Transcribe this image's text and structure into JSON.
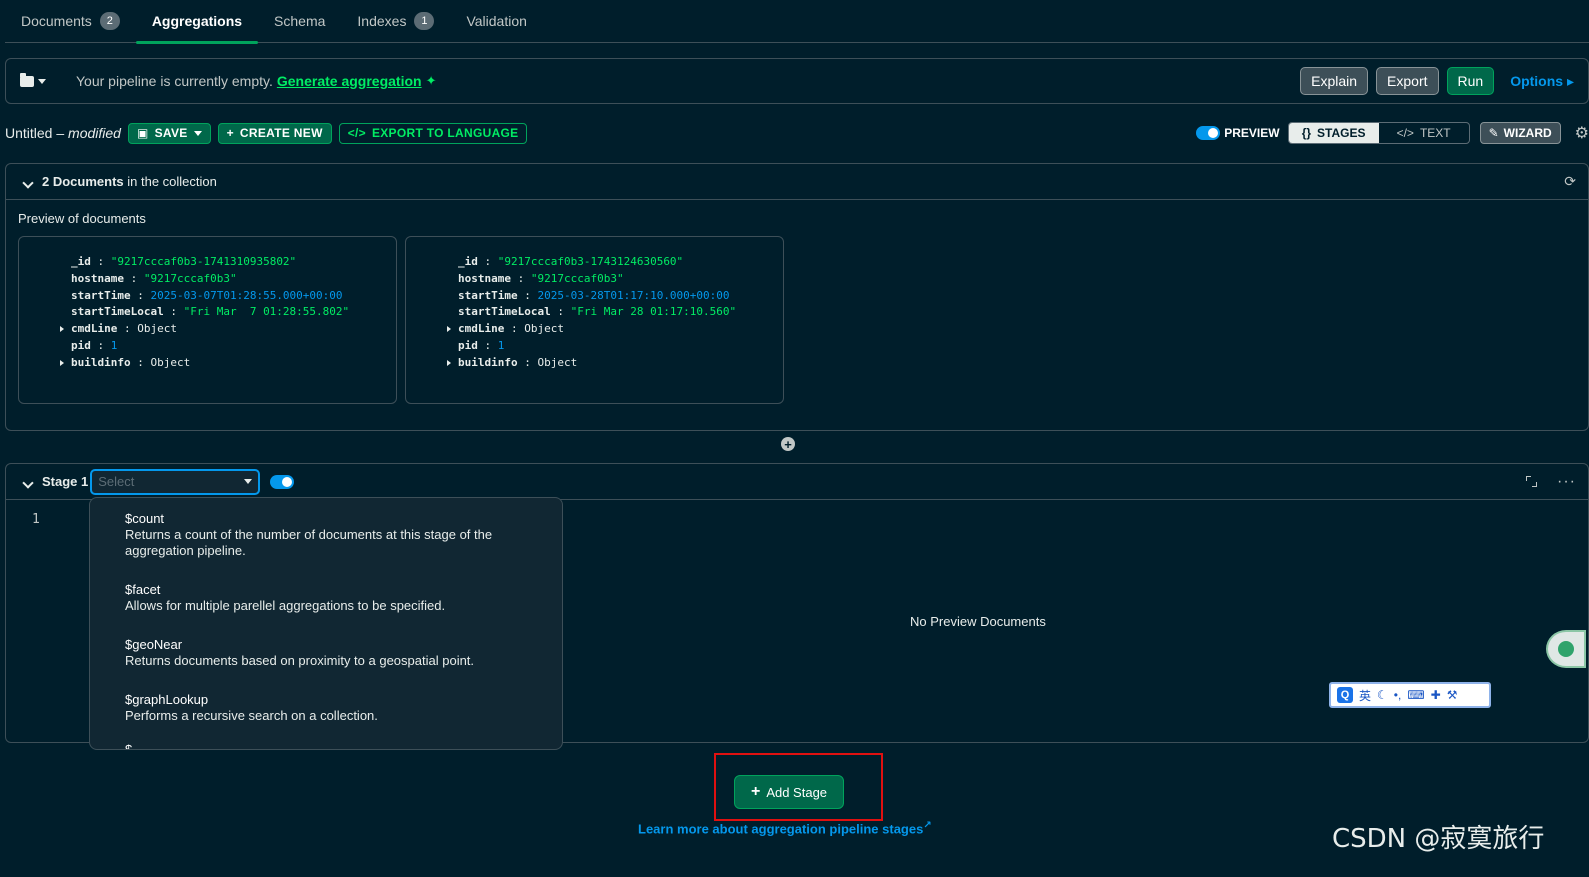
{
  "tabs": [
    {
      "label": "Documents",
      "badge": "2"
    },
    {
      "label": "Aggregations",
      "badge": null
    },
    {
      "label": "Schema",
      "badge": null
    },
    {
      "label": "Indexes",
      "badge": "1"
    },
    {
      "label": "Validation",
      "badge": null
    }
  ],
  "pipeline": {
    "empty_msg": "Your pipeline is currently empty.",
    "generate_link": "Generate aggregation",
    "explain": "Explain",
    "export": "Export",
    "run": "Run",
    "options": "Options"
  },
  "toolbar": {
    "name": "Untitled",
    "modified": "modified",
    "save": "SAVE",
    "create_new": "CREATE NEW",
    "export_lang": "EXPORT TO LANGUAGE",
    "preview": "PREVIEW",
    "stages": "STAGES",
    "text": "TEXT",
    "wizard": "WIZARD"
  },
  "docs": {
    "count": "2 Documents",
    "suffix": "in the collection",
    "preview_title": "Preview of documents",
    "cards": [
      {
        "id": "\"9217cccaf0b3-1741310935802\"",
        "hostname": "\"9217cccaf0b3\"",
        "startTime": "2025-03-07T01:28:55.000+00:00",
        "startTimeLocal": "\"Fri Mar  7 01:28:55.802\"",
        "cmdLine": "Object",
        "pid": "1",
        "buildinfo": "Object"
      },
      {
        "id": "\"9217cccaf0b3-1743124630560\"",
        "hostname": "\"9217cccaf0b3\"",
        "startTime": "2025-03-28T01:17:10.000+00:00",
        "startTimeLocal": "\"Fri Mar 28 01:17:10.560\"",
        "cmdLine": "Object",
        "pid": "1",
        "buildinfo": "Object"
      }
    ],
    "keys": {
      "id": "_id",
      "hostname": "hostname",
      "startTime": "startTime",
      "startTimeLocal": "startTimeLocal",
      "cmdLine": "cmdLine",
      "pid": "pid",
      "buildinfo": "buildinfo"
    }
  },
  "stage": {
    "label": "Stage 1",
    "select_placeholder": "Select",
    "line_number": "1",
    "no_preview": "No Preview Documents"
  },
  "dropdown": {
    "options": [
      {
        "name": "$count",
        "desc": "Returns a count of the number of documents at this stage of the aggregation pipeline."
      },
      {
        "name": "$facet",
        "desc": "Allows for multiple parellel aggregations to be specified."
      },
      {
        "name": "$geoNear",
        "desc": "Returns documents based on proximity to a geospatial point."
      },
      {
        "name": "$graphLookup",
        "desc": "Performs a recursive search on a collection."
      }
    ],
    "partial": "$"
  },
  "footer": {
    "add_stage": "Add Stage",
    "learn_more": "Learn more about aggregation pipeline stages"
  },
  "ime": {
    "q": "Q",
    "lang": "英"
  },
  "watermark": "CSDN @寂寞旅行",
  "colors": {
    "bg": "#001e2b",
    "accent": "#00ed64",
    "link": "#0498ec",
    "highlight": "#e01010"
  }
}
